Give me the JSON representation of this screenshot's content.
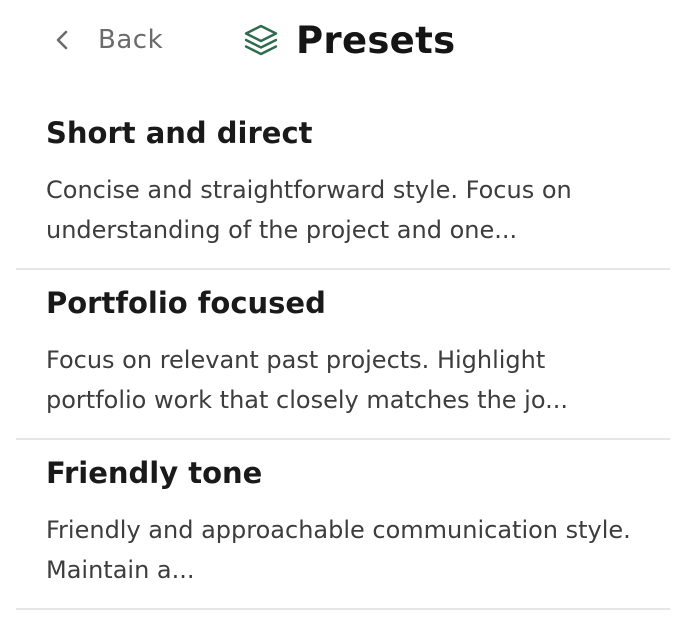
{
  "header": {
    "back_label": "Back",
    "back_icon": "chevron-left-icon",
    "title": "Presets",
    "title_icon": "layers-icon",
    "accent_color": "#2f6b4f"
  },
  "presets": [
    {
      "title": "Short and direct",
      "description": "Concise and straightforward style. Focus on understanding of the project and one..."
    },
    {
      "title": "Portfolio focused",
      "description": "Focus on relevant past projects. Highlight portfolio work that closely matches the jo..."
    },
    {
      "title": "Friendly tone",
      "description": "Friendly and approachable communication style. Maintain a..."
    }
  ]
}
